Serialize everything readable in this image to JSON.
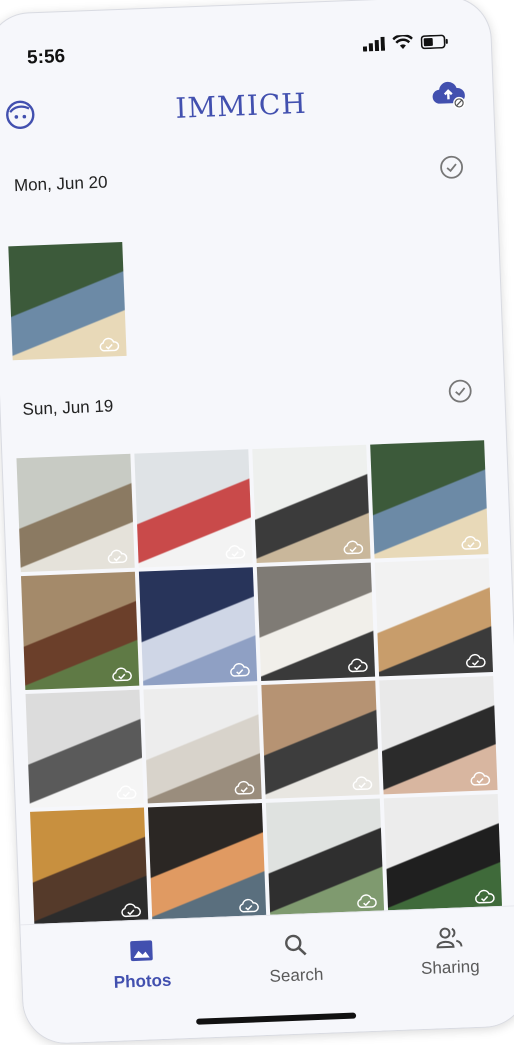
{
  "status_bar": {
    "time": "5:56"
  },
  "header": {
    "title": "IMMICH",
    "avatar_icon": "face-icon",
    "backup_icon": "cloud-upload-icon"
  },
  "groups": [
    {
      "date": "Mon, Jun 20",
      "photos": [
        "office-desk-window"
      ]
    },
    {
      "date": "Sun, Jun 19",
      "photos": [
        "plant-in-pot",
        "white-house-red-roof",
        "dining-room-people",
        "garden-house-blue",
        "wooden-house-sunset",
        "blue-window-room",
        "home-pillow",
        "modern-kitchen",
        "grey-sofa-living-room",
        "white-wall-chair",
        "long-kitchen",
        "laptop-desk-top-view",
        "person-laptop-sweater",
        "dark-room-city-view",
        "living-room-black-chairs",
        "black-sofa-plant"
      ]
    }
  ],
  "nav": {
    "items": [
      {
        "label": "Photos",
        "icon": "photo-icon",
        "active": true
      },
      {
        "label": "Search",
        "icon": "search-icon",
        "active": false
      },
      {
        "label": "Sharing",
        "icon": "people-icon",
        "active": false
      }
    ]
  },
  "colors": {
    "accent": "#4250af",
    "background": "#f6f7fb"
  }
}
